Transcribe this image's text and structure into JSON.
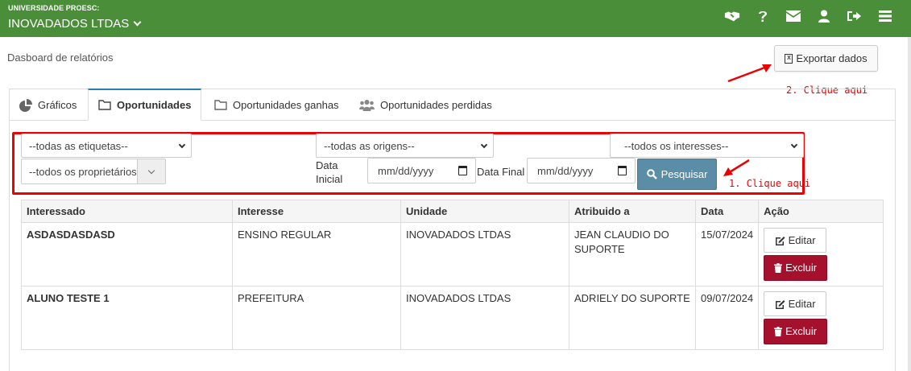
{
  "header": {
    "org_label": "UNIVERSIDADE PROESC:",
    "org_name": "INOVADADOS LTDAS",
    "icons": [
      "handshake-icon",
      "help-icon",
      "envelope-icon",
      "user-icon",
      "sign-out-icon",
      "menu-icon"
    ]
  },
  "page": {
    "breadcrumb": "Dasboard de relatórios",
    "export_label": "Exportar dados"
  },
  "annotations": {
    "export_hint": "2. Clique aqui",
    "search_hint": "1. Clique aqui",
    "color": "#e00000"
  },
  "tabs": [
    {
      "label": "Gráficos",
      "icon": "pie-chart-icon",
      "active": false
    },
    {
      "label": "Oportunidades",
      "icon": "folder-icon",
      "active": true
    },
    {
      "label": "Oportunidades ganhas",
      "icon": "folder-icon",
      "active": false
    },
    {
      "label": "Oportunidades perdidas",
      "icon": "users-icon",
      "active": false
    }
  ],
  "filters": {
    "tags_selected": "--todas as etiquetas--",
    "origins_selected": "--todas as origens--",
    "interests_selected": "--todos os interesses--",
    "owners_selected": "--todos os proprietários",
    "date_start_label": "Data Inicial",
    "date_start_placeholder": "mm/dd/yyyy",
    "date_end_label": "Data Final",
    "date_end_placeholder": "mm/dd/yyyy",
    "search_label": "Pesquisar"
  },
  "table": {
    "columns": [
      "Interessado",
      "Interesse",
      "Unidade",
      "Atribuido a",
      "Data",
      "Ação"
    ],
    "rows": [
      {
        "interessado": "ASDASDASDASD",
        "interesse": "ENSINO REGULAR",
        "unidade": "INOVADADOS LTDAS",
        "atribuido": "JEAN CLAUDIO DO SUPORTE",
        "data": "15/07/2024"
      },
      {
        "interessado": "ALUNO TESTE 1",
        "interesse": "PREFEITURA",
        "unidade": "INOVADADOS LTDAS",
        "atribuido": "ADRIELY DO SUPORTE",
        "data": "09/07/2024"
      }
    ],
    "edit_label": "Editar",
    "delete_label": "Excluir"
  },
  "colors": {
    "topbar": "#4b8e3a",
    "accent_tab": "#2a7fae",
    "search_button": "#5b8ea6",
    "delete_button": "#a5102d"
  }
}
